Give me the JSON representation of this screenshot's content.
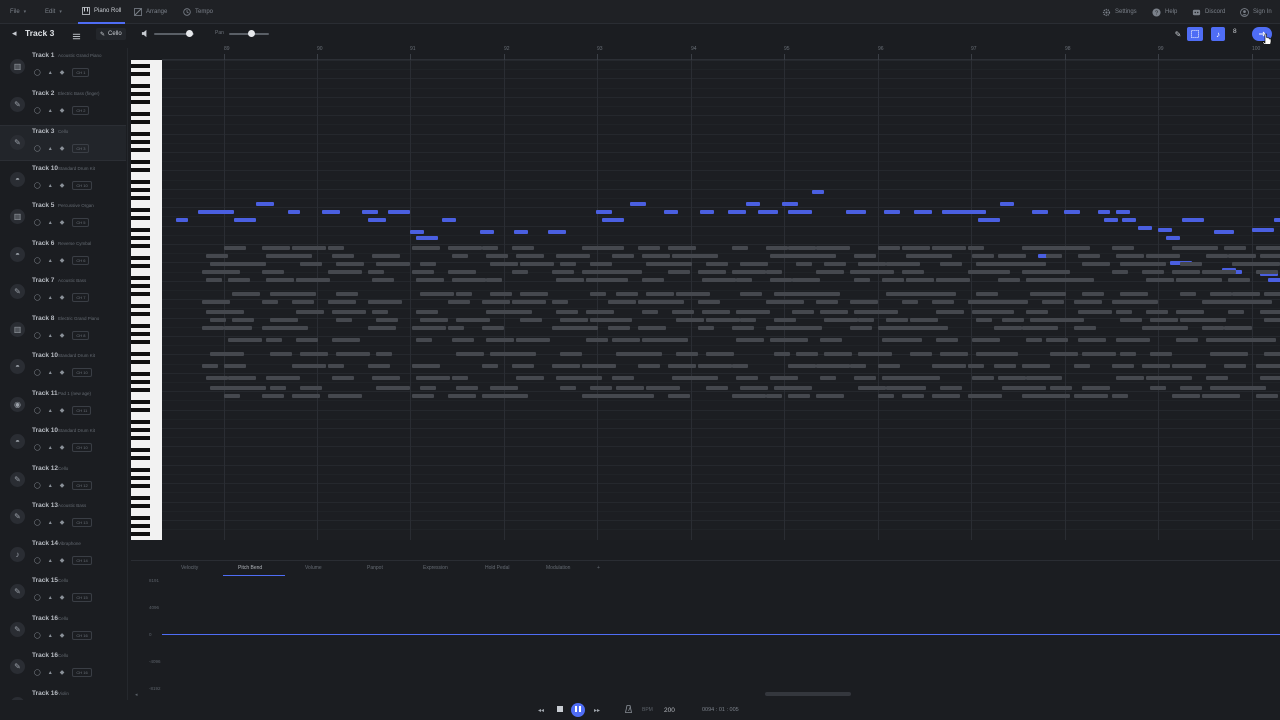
{
  "menubar": {
    "file": "File",
    "edit": "Edit",
    "piano_roll": "Piano Roll",
    "arrange": "Arrange",
    "tempo": "Tempo",
    "settings": "Settings",
    "help": "Help",
    "discord": "Discord",
    "sign_in": "Sign In"
  },
  "header": {
    "track_title": "Track 3",
    "instrument": "Cello",
    "pan_label": "Pan",
    "quantize": "8"
  },
  "ruler_ticks": [
    "89",
    "90",
    "91",
    "92",
    "93",
    "94",
    "95",
    "96",
    "97",
    "98",
    "99",
    "100"
  ],
  "tracks": [
    {
      "name": "Track 1",
      "inst": "Acoustic Grand Piano",
      "ch": "CH 1",
      "icon": "piano-icon",
      "glyph": "▥"
    },
    {
      "name": "Track 2",
      "inst": "Electric Bass (finger)",
      "ch": "CH 2",
      "icon": "guitar-icon",
      "glyph": "✎"
    },
    {
      "name": "Track 3",
      "inst": "Cello",
      "ch": "CH 3",
      "icon": "cello-icon",
      "glyph": "✎"
    },
    {
      "name": "Track 10",
      "inst": "Standard Drum Kit",
      "ch": "CH 10",
      "icon": "drum-icon",
      "glyph": "◓"
    },
    {
      "name": "Track 5",
      "inst": "Percussive Organ",
      "ch": "CH 5",
      "icon": "organ-icon",
      "glyph": "▥"
    },
    {
      "name": "Track 6",
      "inst": "Reverse Cymbal",
      "ch": "CH 6",
      "icon": "drum-icon",
      "glyph": "◓"
    },
    {
      "name": "Track 7",
      "inst": "Acoustic Bass",
      "ch": "CH 7",
      "icon": "guitar-icon",
      "glyph": "✎"
    },
    {
      "name": "Track 8",
      "inst": "Electric Grand Piano",
      "ch": "CH 8",
      "icon": "piano-icon",
      "glyph": "▥"
    },
    {
      "name": "Track 10",
      "inst": "Standard Drum Kit",
      "ch": "CH 10",
      "icon": "drum-icon",
      "glyph": "◓"
    },
    {
      "name": "Track 11",
      "inst": "Pad 1 (new age)",
      "ch": "CH 11",
      "icon": "pad-icon",
      "glyph": "◉"
    },
    {
      "name": "Track 10",
      "inst": "Standard Drum Kit",
      "ch": "CH 10",
      "icon": "drum-icon",
      "glyph": "◓"
    },
    {
      "name": "Track 12",
      "inst": "Cello",
      "ch": "CH 12",
      "icon": "cello-icon",
      "glyph": "✎"
    },
    {
      "name": "Track 13",
      "inst": "Acoustic Bass",
      "ch": "CH 13",
      "icon": "guitar-icon",
      "glyph": "✎"
    },
    {
      "name": "Track 14",
      "inst": "Vibraphone",
      "ch": "CH 14",
      "icon": "bell-icon",
      "glyph": "♪"
    },
    {
      "name": "Track 15",
      "inst": "Cello",
      "ch": "CH 15",
      "icon": "cello-icon",
      "glyph": "✎"
    },
    {
      "name": "Track 16",
      "inst": "Cello",
      "ch": "CH 16",
      "icon": "cello-icon",
      "glyph": "✎"
    },
    {
      "name": "Track 16",
      "inst": "Cello",
      "ch": "CH 16",
      "icon": "cello-icon",
      "glyph": "✎"
    },
    {
      "name": "Track 16",
      "inst": "Violin",
      "ch": "CH 16",
      "icon": "violin-icon",
      "glyph": "✎"
    }
  ],
  "lanes": {
    "tabs": [
      "Velocity",
      "Pitch Bend",
      "Volume",
      "Panpot",
      "Expression",
      "Hold Pedal",
      "Modulation",
      "+"
    ],
    "active": "Pitch Bend",
    "scale": [
      "8191",
      "4096",
      "0",
      "-4096",
      "-8192"
    ]
  },
  "transport": {
    "bpm_label": "BPM",
    "bpm": "200",
    "position": "0094 : 01 : 005"
  },
  "colors": {
    "accent": "#4f6df5",
    "selected_note": "#4a5fe0",
    "other_note": "#45484e"
  }
}
